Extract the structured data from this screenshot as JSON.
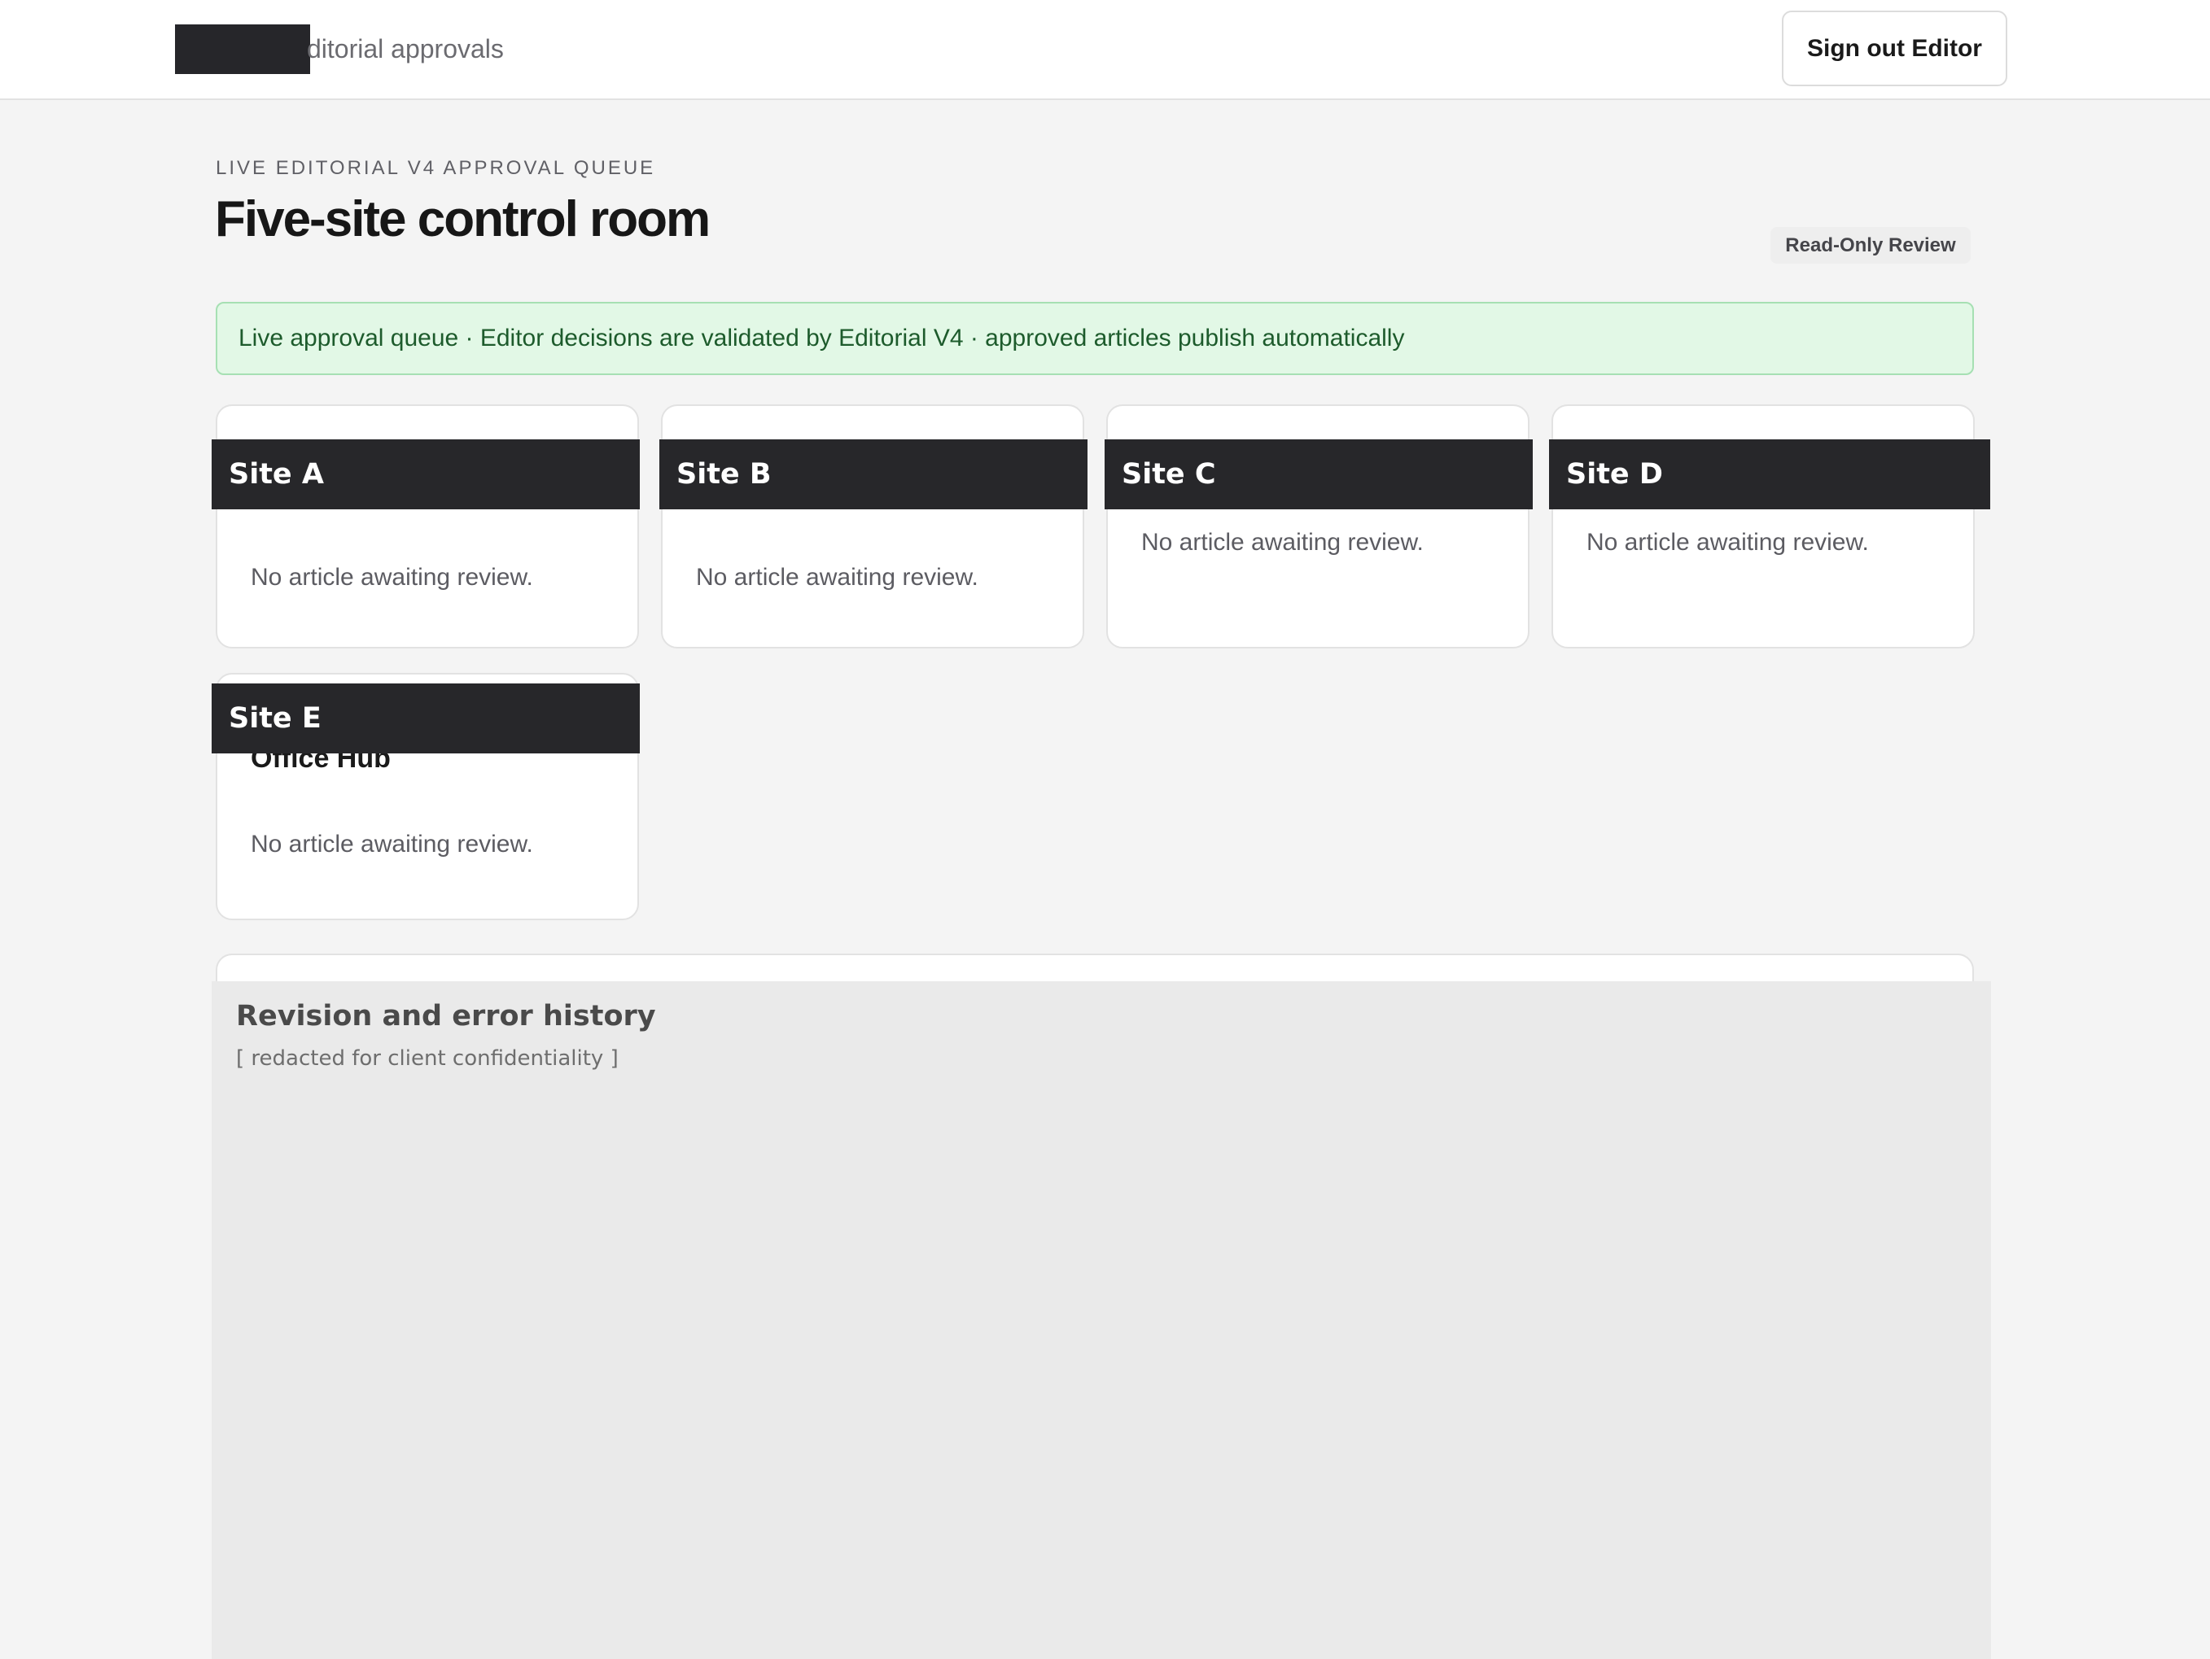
{
  "header": {
    "brand_text": "ditorial approvals",
    "signout_label": "Sign out Editor"
  },
  "page": {
    "eyebrow": "LIVE EDITORIAL V4 APPROVAL QUEUE",
    "title": "Five-site control room",
    "badge": "Read-Only Review"
  },
  "banner": {
    "text": "Live approval queue · Editor decisions are validated by Editorial V4 · approved articles publish automatically"
  },
  "sites": [
    {
      "label": "Site A",
      "empty_text": "No article awaiting review."
    },
    {
      "label": "Site B",
      "empty_text": "No article awaiting review."
    },
    {
      "label": "Site C",
      "empty_text": "No article awaiting review."
    },
    {
      "label": "Site D",
      "empty_text": "No article awaiting review."
    },
    {
      "label": "Site E",
      "subtitle": "Office Hub",
      "empty_text": "No article awaiting review."
    }
  ],
  "history": {
    "title": "Revision and error history",
    "note": "[ redacted for client confidentiality ]"
  }
}
